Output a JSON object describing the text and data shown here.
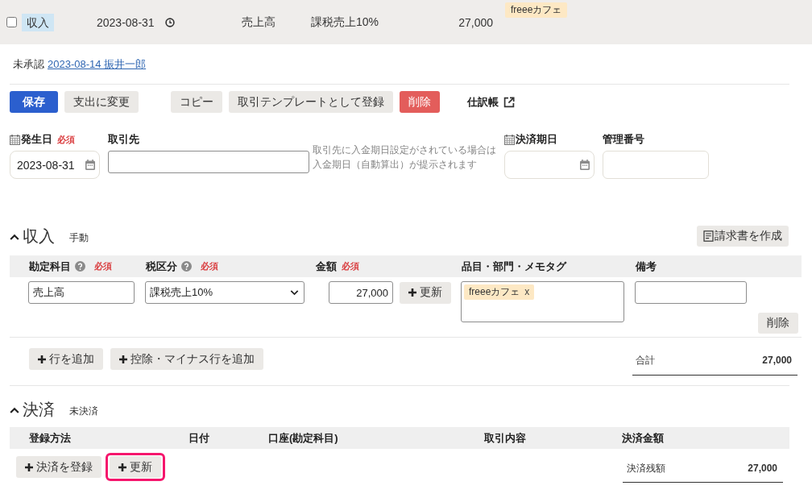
{
  "entry": {
    "checked": false,
    "type": "収入",
    "date": "2023-08-31",
    "account": "売上高",
    "tax": "課税売上10%",
    "amount": "27,000",
    "tags": [
      "freeeカフェ"
    ]
  },
  "approval": {
    "status": "未承認",
    "link": "2023-08-14 振井一郎"
  },
  "action_groups": [
    [
      {
        "label": "保存",
        "kind": "primary"
      },
      {
        "label": "支出に変更",
        "kind": "default"
      }
    ],
    [
      {
        "label": "コピー",
        "kind": "default"
      },
      {
        "label": "取引テンプレートとして登録",
        "kind": "default"
      },
      {
        "label": "削除",
        "kind": "danger"
      },
      {
        "label": "仕訳帳",
        "kind": "external"
      }
    ]
  ],
  "fields": [
    {
      "kind": "date",
      "label": "発生日",
      "required": "必須",
      "value": "2023-08-31"
    },
    {
      "kind": "autocomplete",
      "label": "取引先"
    },
    {
      "kind": "hint",
      "text": "取引先に入金期日設定がされている場合は入金期日（自動算出）が提示されます"
    },
    {
      "kind": "date",
      "label": "決済期日"
    },
    {
      "kind": "text",
      "label": "管理番号"
    }
  ],
  "income": {
    "title": "収入",
    "expanded": true,
    "mode": "手動",
    "invoice_button": "請求書を作成",
    "columns": [
      {
        "label": "勘定科目",
        "help": true,
        "required": "必須"
      },
      {
        "label": "税区分",
        "help": true,
        "required": "必須"
      },
      {
        "label": "金額",
        "help": false,
        "required": "必須"
      },
      {
        "label": "品目・部門・メモタグ",
        "help": false
      },
      {
        "label": "備考",
        "help": false
      }
    ],
    "rows": [
      {
        "account": "売上高",
        "tax": "課税売上10%",
        "amount": "27,000",
        "update_button": "更新",
        "tags": [
          {
            "label": "freeeカフェ",
            "remove": "x"
          }
        ],
        "delete_button": "削除"
      }
    ],
    "add_buttons": [
      "行を追加",
      "控除・マイナス行を追加"
    ],
    "total": {
      "label": "合計",
      "value": "27,000"
    }
  },
  "settlement": {
    "title": "決済",
    "expanded": true,
    "status": "未決済",
    "columns": [
      "登録方法",
      "日付",
      "口座(勘定科目)",
      "取引内容",
      "決済金額"
    ],
    "buttons": [
      {
        "label": "決済を登録",
        "highlighted": false
      },
      {
        "label": "更新",
        "highlighted": true
      }
    ],
    "balance": {
      "label": "決済残額",
      "value": "27,000"
    }
  }
}
